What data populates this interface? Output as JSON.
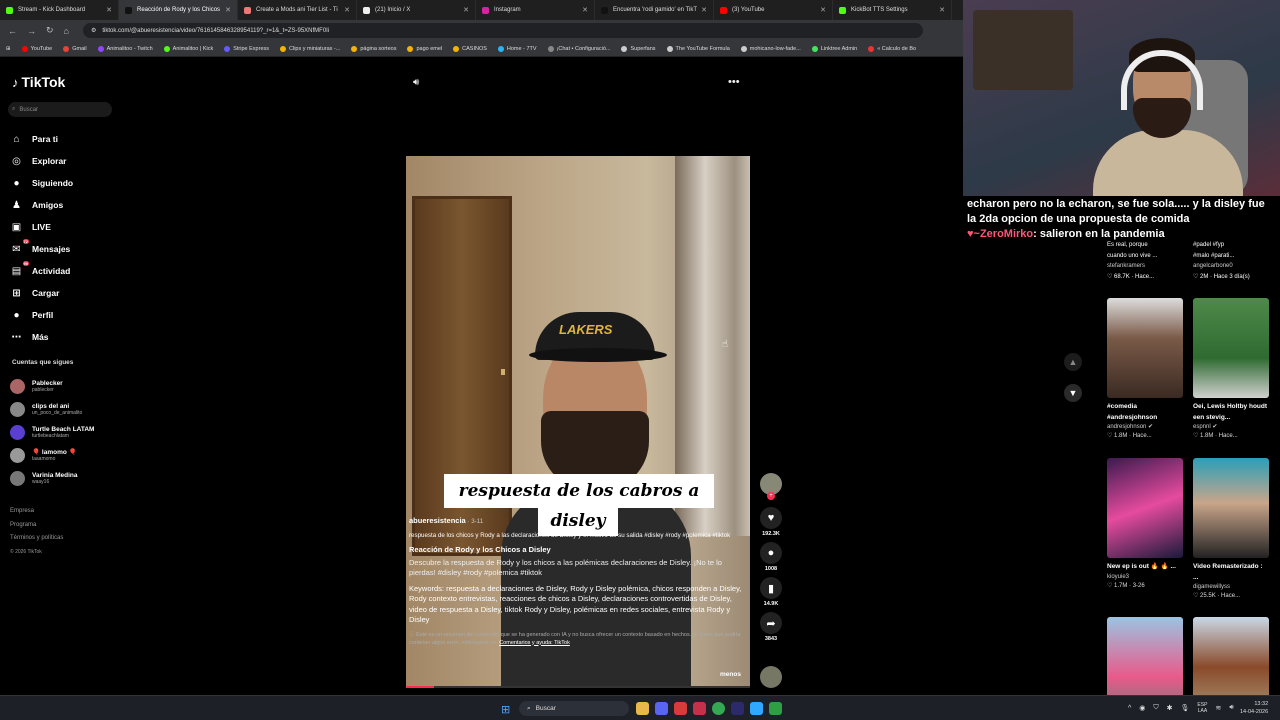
{
  "browser": {
    "tabs": [
      {
        "title": "Stream - Kick Dashboard",
        "fav": "#53fc18"
      },
      {
        "title": "Reacción de Rody y los Chicos",
        "fav": "#111"
      },
      {
        "title": "Create a Mods ani Tier List - Ti",
        "fav": "#e77"
      },
      {
        "title": "(21) Inicio / X",
        "fav": "#eee"
      },
      {
        "title": "Instagram",
        "fav": "#d6249f"
      },
      {
        "title": "Encuentra 'rodi gamido' en TikT",
        "fav": "#111"
      },
      {
        "title": "(3) YouTube",
        "fav": "#ff0000"
      },
      {
        "title": "KickBot TTS Settings",
        "fav": "#53fc18"
      }
    ],
    "url": "tiktok.com/@abueresistencia/video/7616145846328954119?_r=1&_t=ZS-95XNfMF0Ii",
    "bookmarks": [
      {
        "label": "YouTube",
        "color": "#ff0000"
      },
      {
        "label": "Gmail",
        "color": "#ea4335"
      },
      {
        "label": "Animalitoo - Twitch",
        "color": "#9146ff"
      },
      {
        "label": "Animalitoo | Kick",
        "color": "#53fc18"
      },
      {
        "label": "Stripe Express",
        "color": "#635bff"
      },
      {
        "label": "Clips y miniaturas -...",
        "color": "#f4b400"
      },
      {
        "label": "página sorteos",
        "color": "#f4b400"
      },
      {
        "label": "pago emel",
        "color": "#f4b400"
      },
      {
        "label": "CASINOS",
        "color": "#f4b400"
      },
      {
        "label": "Home - 7TV",
        "color": "#29b6f6"
      },
      {
        "label": "¡Chat • Configuració...",
        "color": "#888"
      },
      {
        "label": "Superfans",
        "color": "#ccc"
      },
      {
        "label": "The YouTube Formula",
        "color": "#ccc"
      },
      {
        "label": "mohicano-low-fade...",
        "color": "#ccc"
      },
      {
        "label": "Linktree Admin",
        "color": "#43e55e"
      },
      {
        "label": "« Calculo de Bo",
        "color": "#e33"
      }
    ]
  },
  "tiktok": {
    "logo": "TikTok",
    "search_placeholder": "Buscar",
    "nav": [
      {
        "label": "Para ti",
        "icon": "home-icon",
        "glyph": "⌂"
      },
      {
        "label": "Explorar",
        "icon": "compass-icon",
        "glyph": "◎"
      },
      {
        "label": "Siguiendo",
        "icon": "following-icon",
        "glyph": "●"
      },
      {
        "label": "Amigos",
        "icon": "friends-icon",
        "glyph": "♟"
      },
      {
        "label": "LIVE",
        "icon": "live-icon",
        "glyph": "▣"
      },
      {
        "label": "Mensajes",
        "icon": "message-icon",
        "glyph": "✉",
        "badge": "72"
      },
      {
        "label": "Actividad",
        "icon": "activity-icon",
        "glyph": "▤",
        "badge": "99"
      },
      {
        "label": "Cargar",
        "icon": "upload-icon",
        "glyph": "⊞"
      },
      {
        "label": "Perfil",
        "icon": "profile-icon",
        "glyph": "●"
      },
      {
        "label": "Más",
        "icon": "more-icon",
        "glyph": "⋯"
      }
    ],
    "following_title": "Cuentas que sigues",
    "following": [
      {
        "name": "Pablecker",
        "handle": "pablecker",
        "color": "#a66"
      },
      {
        "name": "clips del ani",
        "handle": "un_poco_de_animalito",
        "color": "#888"
      },
      {
        "name": "Turtle Beach LATAM",
        "handle": "turtlebeachlatam",
        "color": "#5b3fd1"
      },
      {
        "name": "🎈 lamomo 🎈",
        "handle": "laaamomo",
        "color": "#999"
      },
      {
        "name": "Varinia Medina",
        "handle": "waay16",
        "color": "#777"
      }
    ],
    "footer": [
      "Empresa",
      "Programa",
      "Términos y políticas",
      "© 2026 TikTok"
    ],
    "video": {
      "caption_line1": "respuesta de los cabros a",
      "caption_line2": "disley",
      "cap_logo": "LAKERS",
      "author": "abueresistencia",
      "date": "· 3-11",
      "description": "respuesta de los chicos y Rody a las declaraciones de Disley y el motivo de su salida #disley #rody #polemica #tiktok",
      "ai_title": "Reacción de Rody y los Chicos a Disley",
      "ai_desc": "Descubre la respuesta de Rody y los chicos a las polémicas declaraciones de Disley. ¡No te lo pierdas! #disley #rody #polemica #tiktok",
      "keywords": "Keywords: respuesta a declaraciones de Disley, Rody y Disley polémica, chicos responden a Disley, Rody contexto entrevistas, reacciones de chicos a Disley, declaraciones controvertidas de Disley, video de respuesta a Disley, tiktok Rody y Disley, polémicas en redes sociales, entrevista Rody y Disley",
      "ai_notice": "ⓘ Este es un resumen del contenido que se ha generado con IA y no busca ofrecer un contexto basado en hechos. Si crees que podría contener algún error, infórmanos en:",
      "ai_link": "Comentarios y ayuda: TikTok",
      "less": "menos",
      "progress": 0.08
    },
    "actions": [
      {
        "name": "like",
        "icon": "heart-icon",
        "glyph": "♥",
        "count": "192.3K"
      },
      {
        "name": "comment",
        "icon": "comment-icon",
        "glyph": "●",
        "count": "1008"
      },
      {
        "name": "save",
        "icon": "bookmark-icon",
        "glyph": "▮",
        "count": "14.9K"
      },
      {
        "name": "share",
        "icon": "share-icon",
        "glyph": "➦",
        "count": "3843"
      }
    ]
  },
  "stream_chat": {
    "line": "echaron pero no la echaron, se fue sola..... y la disley fue la 2da opcion de una propuesta de comida",
    "user": "~ZeroMirko",
    "message": ": salieron en la pandemia"
  },
  "grid": {
    "top_left": {
      "title1": "Es real, porque",
      "title2": "cuando uno vive ...",
      "author": "stefankramers",
      "stats": "♡ 68.7K · Hace..."
    },
    "top_right": {
      "title1": "#padel #fyp",
      "title2": "#malo #parati...",
      "author": "angelcarbone0",
      "stats": "♡ 2M · Hace 3 día(s)"
    },
    "cards": [
      {
        "title": "#comedia #andresjohnson",
        "author": "andresjohnson ✔",
        "stats": "♡ 1.8M · Hace...",
        "bg": "linear-gradient(180deg,#ddd 0%,#7a5a48 40%,#3a2a22 100%)"
      },
      {
        "title": "Oei, Lewis Holtby houdt een stevig...",
        "author": "espnnl ✔",
        "stats": "♡ 1.8M · Hace...",
        "bg": "linear-gradient(180deg,#4f8a4a,#2f6b31 60%,#d0d0d0)"
      },
      {
        "title": "New ep is out 🔥 🔥 ...",
        "author": "kioyuie3",
        "stats": "♡ 1.7M · 3-26",
        "bg": "linear-gradient(160deg,#3b1a4f,#e64b9e 50%,#1a1a3a)"
      },
      {
        "title": "Video Remasterizado : ...",
        "author": "digamewillyss",
        "stats": "♡ 25.5K · Hace...",
        "bg": "linear-gradient(180deg,#2a9fb8,#c9a58a 45%,#222)"
      },
      {
        "title": "",
        "author": "",
        "stats": "",
        "bg": "linear-gradient(180deg,#9bc4e2,#e85a8a 60%,#777)"
      },
      {
        "title": "",
        "author": "",
        "stats": "",
        "bg": "linear-gradient(180deg,#c9d8e6,#8a4a2a 50%,#a89a7a)"
      }
    ]
  },
  "taskbar": {
    "search": "Buscar",
    "lang": "ESP\nLAA",
    "time": "13:32",
    "date": "14-04-2026"
  }
}
